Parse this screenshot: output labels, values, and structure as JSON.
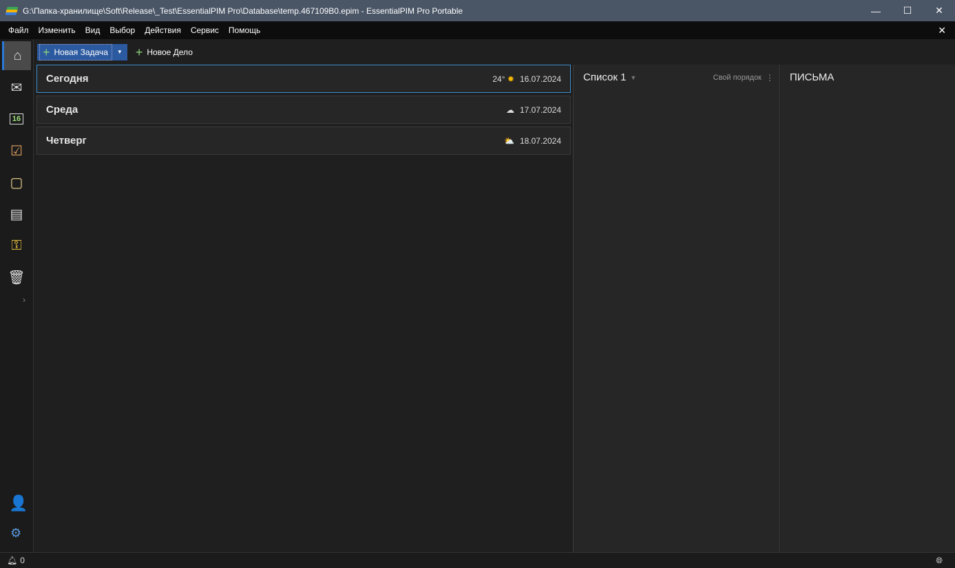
{
  "window": {
    "title": "G:\\Папка-хранилище\\Soft\\Release\\_Test\\EssentialPIM Pro\\Database\\temp.467109B0.epim - EssentialPIM Pro Portable"
  },
  "menu": [
    "Файл",
    "Изменить",
    "Вид",
    "Выбор",
    "Действия",
    "Сервис",
    "Помощь"
  ],
  "toolbar": {
    "new_task": "Новая Задача",
    "new_todo": "Новое Дело"
  },
  "calendar_icon_day": "16",
  "days": [
    {
      "name": "Сегодня",
      "temp": "24°",
      "weather": "sunny",
      "date": "16.07.2024"
    },
    {
      "name": "Среда",
      "temp": "",
      "weather": "cloudy",
      "date": "17.07.2024"
    },
    {
      "name": "Четверг",
      "temp": "",
      "weather": "partly-cloudy",
      "date": "18.07.2024"
    }
  ],
  "list": {
    "title": "Список 1",
    "sort": "Свой порядок"
  },
  "mail": {
    "title": "ПИСЬМА"
  },
  "status": {
    "notifications": "0"
  }
}
